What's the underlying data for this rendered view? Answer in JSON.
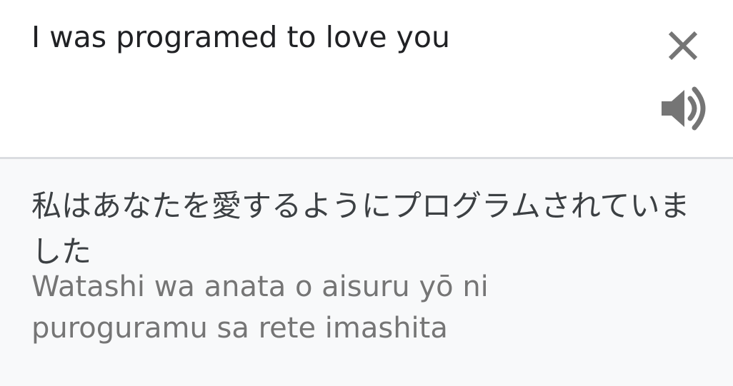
{
  "input": {
    "text": "I was programed to love you",
    "clear_icon": "close-icon",
    "speak_icon": "speaker-icon"
  },
  "output": {
    "translation": "私はあなたを愛するようにプログラムされていました",
    "romanization": "Watashi wa anata o aisuru yō ni puroguramu sa rete imashita"
  },
  "colors": {
    "input_bg": "#ffffff",
    "output_bg": "#f8f9fa",
    "divider": "#dadce0",
    "icon": "#757575",
    "source_text": "#202124",
    "translation_text": "#3c4043",
    "romanization_text": "#757575"
  }
}
